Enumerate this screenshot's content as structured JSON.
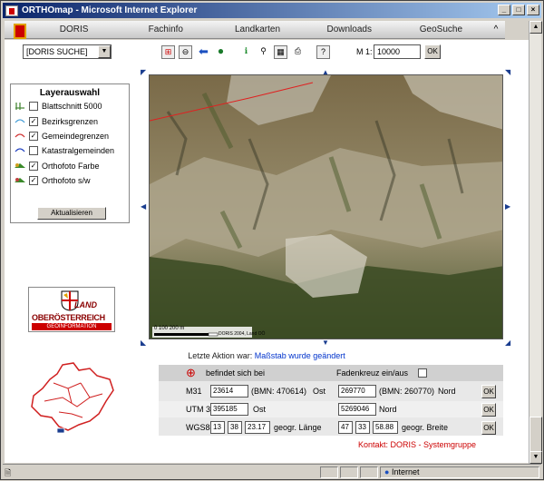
{
  "window": {
    "title": "ORTHOmap - Microsoft Internet Explorer",
    "min": "_",
    "max": "□",
    "close": "×"
  },
  "menu": {
    "items": [
      "DORIS",
      "Fachinfo",
      "Landkarten",
      "Downloads",
      "GeoSuche"
    ],
    "extra": "^"
  },
  "toolbar": {
    "dataset": "[DORIS SUCHE]",
    "scale_label": "M 1:",
    "scale_value": "10000",
    "ok": "OK",
    "help": "?"
  },
  "layers": {
    "title": "Layerauswahl",
    "items": [
      {
        "label": "Blattschnitt 5000",
        "checked": false,
        "color": "#4a8a3a"
      },
      {
        "label": "Bezirksgrenzen",
        "checked": true,
        "color": "#4aa0d8"
      },
      {
        "label": "Gemeindegrenzen",
        "checked": true,
        "color": "#d03030"
      },
      {
        "label": "Katastralgemeinden",
        "checked": false,
        "color": "#2040c0"
      },
      {
        "label": "Orthofoto Farbe",
        "checked": true,
        "color": "#3a8a2a"
      },
      {
        "label": "Orthofoto s/w",
        "checked": true,
        "color": "#3a8a2a"
      }
    ],
    "update": "Aktualisieren"
  },
  "logo": {
    "land": "LAND",
    "name": "OBERÖSTERREICH",
    "geo": "GEOINFORMATION"
  },
  "map": {
    "scalebar": "0  100  200 m",
    "copyright": "DORIS 2004, Land OÖ"
  },
  "status": {
    "prefix": "Letzte Aktion war:",
    "action": "Maßstab wurde geändert"
  },
  "coords": {
    "header": "befindet sich bei",
    "crosshair": "Fadenkreuz ein/aus",
    "m31": {
      "label": "M31",
      "x": "23614",
      "bmn_x": "(BMN: 470614)",
      "ost": "Ost",
      "y": "269770",
      "bmn_y": "(BMN: 260770)",
      "nord": "Nord",
      "ok": "OK"
    },
    "utm": {
      "label": "UTM 33N",
      "x": "395185",
      "ost": "Ost",
      "y": "5269046",
      "nord": "Nord",
      "ok": "OK"
    },
    "wgs": {
      "label": "WGS84",
      "lon_d": "13",
      "lon_m": "38",
      "lon_s": "23.17",
      "lon_lbl": "geogr. Länge",
      "lat_d": "47",
      "lat_m": "33",
      "lat_s": "58.88",
      "lat_lbl": "geogr. Breite",
      "ok": "OK"
    }
  },
  "kontakt": "Kontakt: DORIS - Systemgruppe",
  "statusbar": {
    "zone": "Internet"
  }
}
